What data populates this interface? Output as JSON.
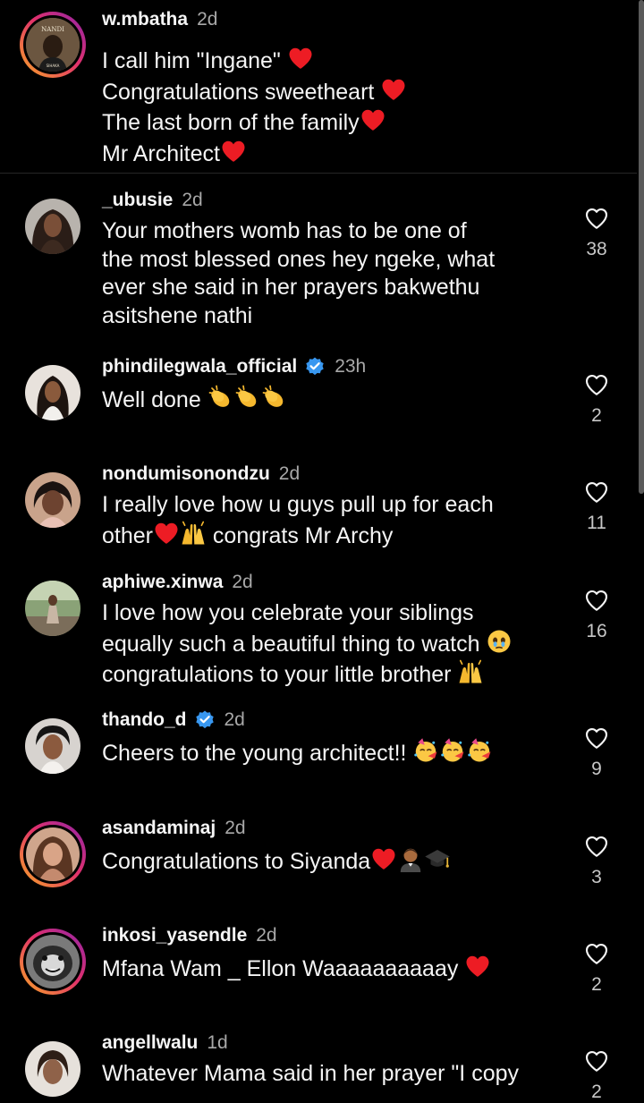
{
  "caption": {
    "username": "w.mbatha",
    "time": "2d",
    "lines": [
      "I call him \"Ingane\"",
      "Congratulations sweetheart",
      "The last born of the family",
      "Mr Architect"
    ],
    "avatar_text": [
      "NANDI",
      "SIHAKA"
    ]
  },
  "comments": [
    {
      "username": "_ubusie",
      "time": "2d",
      "lines": [
        "Your mothers womb has to be one of",
        "the most blessed ones hey ngeke, what",
        "ever she said in her prayers bakwethu",
        "asitshene nathi"
      ],
      "likes": "38"
    },
    {
      "username": "phindilegwala_official",
      "time": "23h",
      "lines": [
        "Well done"
      ],
      "likes": "2"
    },
    {
      "username": "nondumisonondzu",
      "time": "2d",
      "lines": [
        "I really love how u guys pull up for each",
        "other",
        " congrats Mr Archy"
      ],
      "likes": "11"
    },
    {
      "username": "aphiwe.xinwa",
      "time": "2d",
      "lines": [
        "I love how you celebrate your siblings",
        "equally such a beautiful thing to watch",
        "congratulations to your little brother"
      ],
      "likes": "16"
    },
    {
      "username": "thando_d",
      "time": "2d",
      "lines": [
        "Cheers to the young architect!!"
      ],
      "likes": "9"
    },
    {
      "username": "asandaminaj",
      "time": "2d",
      "lines": [
        "Congratulations to Siyanda"
      ],
      "likes": "3"
    },
    {
      "username": "inkosi_yasendle",
      "time": "2d",
      "lines": [
        "Mfana Wam _ Ellon Waaaaaaaaaay"
      ],
      "likes": "2"
    },
    {
      "username": "angellwalu",
      "time": "1d",
      "lines": [
        "Whatever Mama said in her prayer \"I copy"
      ],
      "likes": "2"
    }
  ],
  "icons": {
    "like": "heart-outline-icon",
    "verified": "verified-badge-icon"
  },
  "colors": {
    "background": "#000000",
    "text": "#f5f5f5",
    "secondary": "#a8a8a8",
    "verified": "#3897f0",
    "heart": "#ed1c24"
  }
}
